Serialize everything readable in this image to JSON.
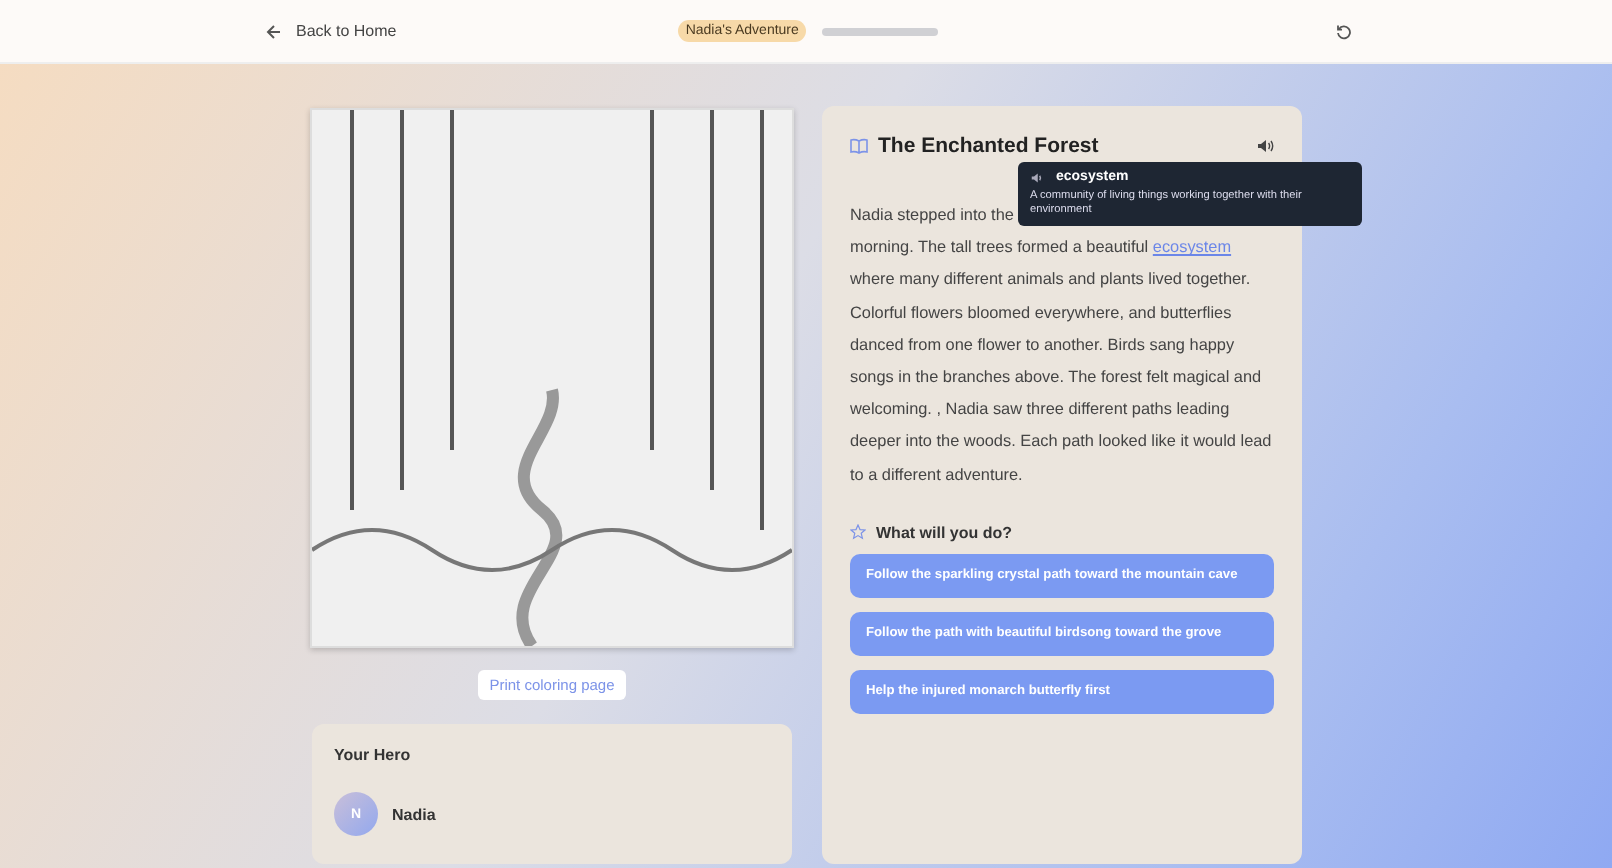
{
  "header": {
    "back_label": "Back to Home",
    "story_badge": "Nadia's Adventure",
    "progress": {
      "level": 0
    }
  },
  "coloring": {
    "print_label": "Print coloring page"
  },
  "story": {
    "title": "The Enchanted Forest",
    "first_line": "Nadia stepped into the",
    "before_link": "morning. The tall trees formed a beautiful",
    "link": "ecosystem",
    "after_link": "where many different animals and plants lived together. Colorful flowers bloomed everywhere, and butterflies danced from one flower to another. Birds sang happy songs in the branches above. The forest felt magical and welcoming. , Nadia saw three different paths leading deeper into the woods. Each path looked like it would lead to a different adventure.",
    "tooltip": {
      "word": "ecosystem",
      "definition": "A community of living things working together with their environment"
    },
    "choices_title": "What will you do?",
    "choices": [
      "Follow the sparkling crystal path toward the mountain cave",
      "Follow the path with beautiful birdsong toward the grove",
      "Help the injured monarch butterfly first"
    ]
  },
  "hero": {
    "title": "Your Hero",
    "initial": "N",
    "name": "Nadia"
  }
}
